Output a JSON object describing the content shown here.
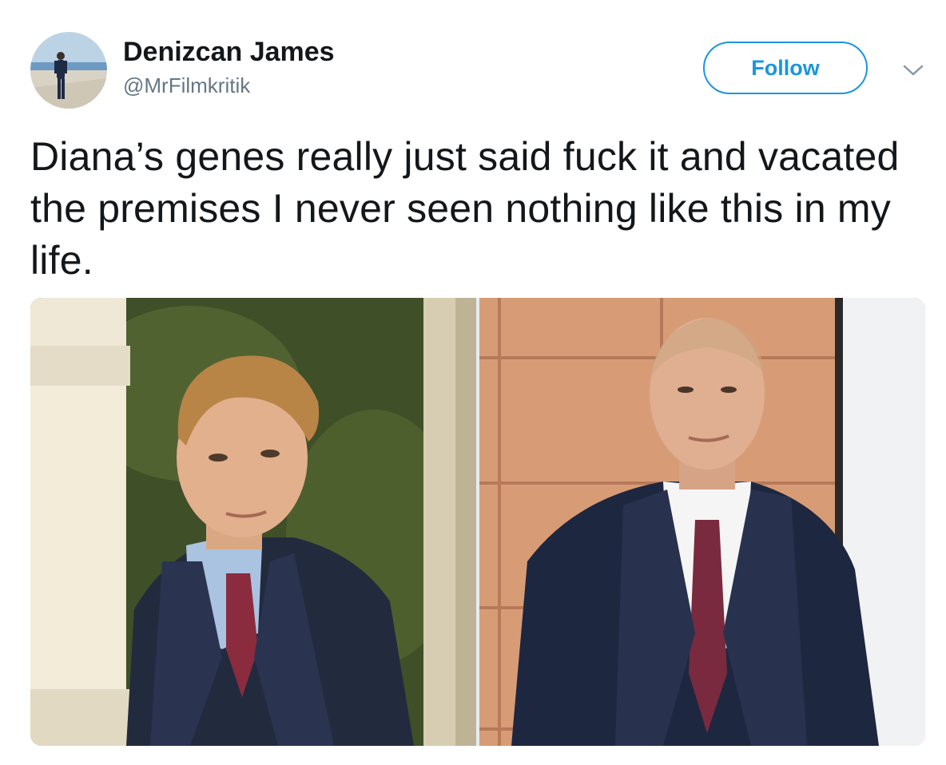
{
  "tweet": {
    "author": {
      "display_name": "Denizcan James",
      "handle": "@MrFilmkritik",
      "avatar_icon": "avatar-photo"
    },
    "follow_label": "Follow",
    "menu_icon": "chevron-down-icon",
    "text": "Diana’s genes really just said fuck it and vacated the premises I never seen nothing like this in my life.",
    "media": {
      "count": 2
    }
  },
  "colors": {
    "accent": "#1b95e0",
    "text_primary": "#14171a",
    "text_secondary": "#657786"
  }
}
